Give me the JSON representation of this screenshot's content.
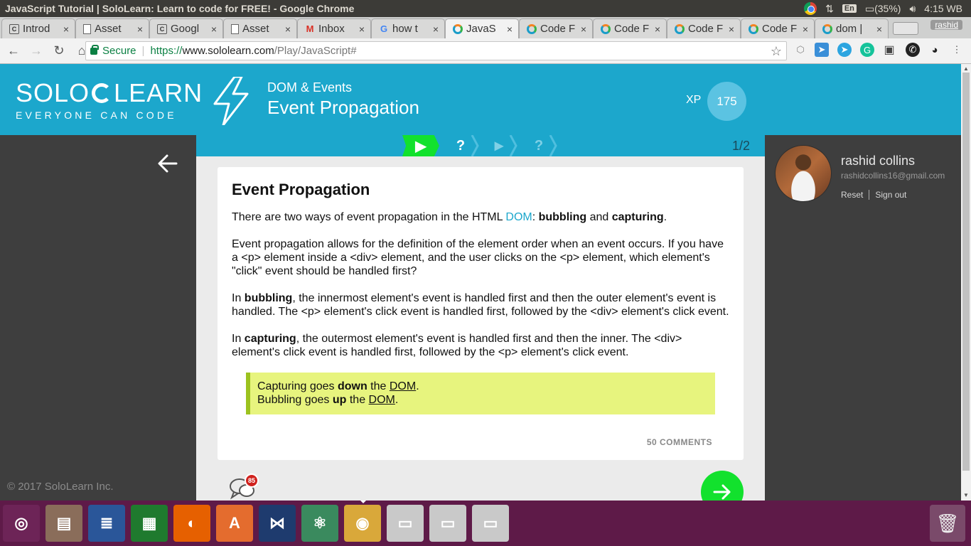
{
  "os": {
    "window_title": "JavaScript Tutorial | SoloLearn: Learn to code for FREE! - Google Chrome",
    "keyboard_layout": "En",
    "battery": "(35%)",
    "clock": "4:15 WB"
  },
  "tabs": [
    {
      "icon": "c-icon",
      "title": "Introd",
      "active": false
    },
    {
      "icon": "doc-icon",
      "title": "Asset",
      "active": false
    },
    {
      "icon": "c-icon",
      "title": "Googl",
      "active": false
    },
    {
      "icon": "doc-icon",
      "title": "Asset",
      "active": false
    },
    {
      "icon": "gmail-icon",
      "title": "Inbox",
      "active": false
    },
    {
      "icon": "google-icon",
      "title": "how t",
      "active": false
    },
    {
      "icon": "sololearn-icon",
      "title": "JavaS",
      "active": true
    },
    {
      "icon": "sololearn-icon",
      "title": "Code F",
      "active": false
    },
    {
      "icon": "sololearn-icon",
      "title": "Code F",
      "active": false
    },
    {
      "icon": "sololearn-icon",
      "title": "Code F",
      "active": false
    },
    {
      "icon": "sololearn-icon",
      "title": "Code F",
      "active": false
    },
    {
      "icon": "sololearn-icon",
      "title": "dom |",
      "active": false
    }
  ],
  "profile_badge": "rashid",
  "address": {
    "secure_label": "Secure",
    "url_scheme": "https://",
    "url_host": "www.sololearn.com",
    "url_path": "/Play/JavaScript#"
  },
  "header": {
    "logo_word_left": "SOLO",
    "logo_word_right": "LEARN",
    "logo_tagline": "EVERYONE CAN CODE",
    "lesson_category": "DOM & Events",
    "lesson_title": "Event Propagation",
    "xp_label": "XP",
    "xp_value": "175"
  },
  "progress": {
    "steps": [
      "play",
      "question",
      "play",
      "question"
    ],
    "pager": "1/2"
  },
  "lesson": {
    "title": "Event Propagation",
    "p1_a": "There are two ways of event propagation in the HTML ",
    "p1_link": "DOM",
    "p1_b": ": ",
    "p1_bold1": "bubbling",
    "p1_c": " and ",
    "p1_bold2": "capturing",
    "p1_d": ".",
    "p2": "Event propagation allows for the definition of the element order when an event occurs. If you have a <p> element inside a <div> element, and the user clicks on the <p> element, which element's \"click\" event should be handled first?",
    "p3_a": "In ",
    "p3_bold": "bubbling",
    "p3_b": ", the innermost element's event is handled first and then the outer element's event is handled. The <p> element's click event is handled first, followed by the <div> element's click event.",
    "p4_a": "In ",
    "p4_bold": "capturing",
    "p4_b": ", the outermost element's event is handled first and then the inner. The <div> element's click event is handled first, followed by the <p> element's click event.",
    "note_l1_a": "Capturing goes ",
    "note_l1_bold": "down",
    "note_l1_b": " the ",
    "note_l1_u": "DOM",
    "note_l1_c": ".",
    "note_l2_a": "Bubbling goes ",
    "note_l2_bold": "up",
    "note_l2_b": " the ",
    "note_l2_u": "DOM",
    "note_l2_c": ".",
    "comments": "50 COMMENTS"
  },
  "discussion_badge": "85",
  "user": {
    "name": "rashid collins",
    "email": "rashidcollins16@gmail.com",
    "reset": "Reset",
    "signout": "Sign out"
  },
  "footer": {
    "copyright": "© 2017 SoloLearn Inc."
  },
  "launcher": [
    {
      "name": "ubuntu-dash-icon",
      "color": "#6d2457"
    },
    {
      "name": "files-icon",
      "color": "#8a6d5a"
    },
    {
      "name": "writer-icon",
      "color": "#2a5699"
    },
    {
      "name": "calc-icon",
      "color": "#1f7a2e"
    },
    {
      "name": "firefox-icon",
      "color": "#e66000"
    },
    {
      "name": "software-center-icon",
      "color": "#e46c2e"
    },
    {
      "name": "vscode-icon",
      "color": "#1e3b6e"
    },
    {
      "name": "atom-icon",
      "color": "#3a8a5e"
    },
    {
      "name": "chrome-icon",
      "color": "#d9a83a"
    },
    {
      "name": "drive-icon",
      "color": "#c9c9c9"
    },
    {
      "name": "drive-icon",
      "color": "#c9c9c9"
    },
    {
      "name": "drive-icon",
      "color": "#c9c9c9"
    }
  ],
  "colors": {
    "brand": "#1ca7cc",
    "accent_green": "#12e12d",
    "note_bg": "#e7f47e"
  }
}
